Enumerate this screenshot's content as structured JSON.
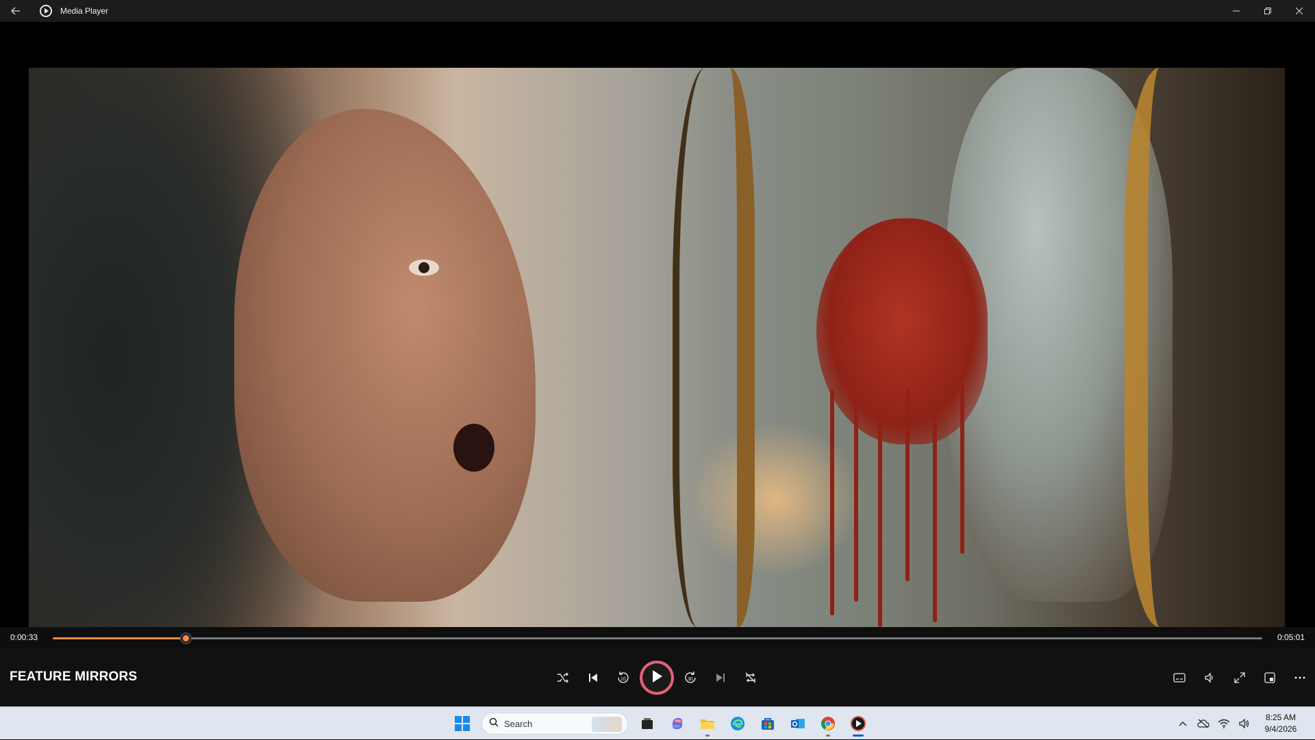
{
  "window": {
    "title": "Media Player"
  },
  "player": {
    "current_time": "0:00:33",
    "total_time": "0:05:01",
    "progress": 0.11,
    "media_title": "FEATURE MIRRORS",
    "accent_color": "#ff8a3d"
  },
  "taskbar": {
    "search_placeholder": "Search",
    "clock_time": "8:25 AM",
    "clock_date": "9/4/2026"
  },
  "icons": {
    "titlebar": [
      "back-arrow-icon",
      "media-player-icon",
      "minimize-icon",
      "restore-icon",
      "close-icon"
    ],
    "controls": [
      "shuffle-icon",
      "previous-icon",
      "rewind-10-icon",
      "play-icon",
      "forward-30-icon",
      "next-icon",
      "repeat-icon"
    ],
    "right_controls": [
      "subtitles-icon",
      "volume-icon",
      "fullscreen-icon",
      "mini-player-icon",
      "more-icon"
    ],
    "taskbar_apps": [
      "windows-start-icon",
      "task-view-icon",
      "copilot-icon",
      "file-explorer-icon",
      "edge-icon",
      "microsoft-store-icon",
      "outlook-icon",
      "chrome-icon",
      "media-player-icon"
    ],
    "tray": [
      "chevron-up-icon",
      "onedrive-icon",
      "wifi-icon",
      "speaker-icon"
    ]
  }
}
